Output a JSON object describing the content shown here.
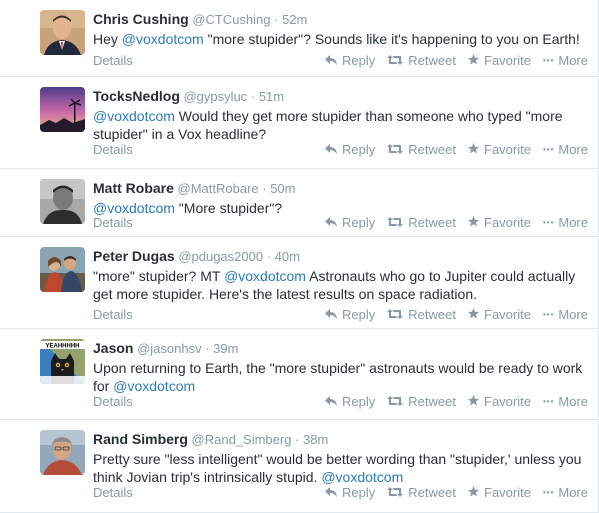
{
  "actions": {
    "details": "Details",
    "reply": "Reply",
    "retweet": "Retweet",
    "favorite": "Favorite",
    "more": "More"
  },
  "tweets": [
    {
      "name": "Chris Cushing",
      "handle": "@CTCushing",
      "time": "52m",
      "text": [
        {
          "t": "Hey ",
          "m": false
        },
        {
          "t": "@voxdotcom",
          "m": true
        },
        {
          "t": " \"more stupider\"?  Sounds like it's happening to you on Earth!",
          "m": false
        }
      ]
    },
    {
      "name": "TocksNedlog",
      "handle": "@gypsyluc",
      "time": "51m",
      "text": [
        {
          "t": "@voxdotcom",
          "m": true
        },
        {
          "t": " Would they get more stupider than someone who typed \"more stupider\" in a Vox headline?",
          "m": false
        }
      ]
    },
    {
      "name": "Matt Robare",
      "handle": "@MattRobare",
      "time": "50m",
      "text": [
        {
          "t": "@voxdotcom",
          "m": true
        },
        {
          "t": " \"More stupider\"?",
          "m": false
        }
      ]
    },
    {
      "name": "Peter Dugas",
      "handle": "@pdugas2000",
      "time": "40m",
      "text": [
        {
          "t": "\"more\" stupider? MT ",
          "m": false
        },
        {
          "t": "@voxdotcom",
          "m": true
        },
        {
          "t": " Astronauts who go to Jupiter could actually get more stupider. Here's the latest results on space radiation.",
          "m": false
        }
      ]
    },
    {
      "name": "Jason",
      "handle": "@jasonhsv",
      "time": "39m",
      "avatar_text": "YEAHHHHH",
      "text": [
        {
          "t": "Upon returning to Earth, the \"more stupider\" astronauts would be ready to work for ",
          "m": false
        },
        {
          "t": "@voxdotcom",
          "m": true
        }
      ]
    },
    {
      "name": "Rand Simberg",
      "handle": "@Rand_Simberg",
      "time": "38m",
      "text": [
        {
          "t": "Pretty sure \"less intelligent\" would be better wording than \"stupider,' unless you think Jovian trip's intrinsically stupid. ",
          "m": false
        },
        {
          "t": "@voxdotcom",
          "m": true
        }
      ]
    }
  ]
}
